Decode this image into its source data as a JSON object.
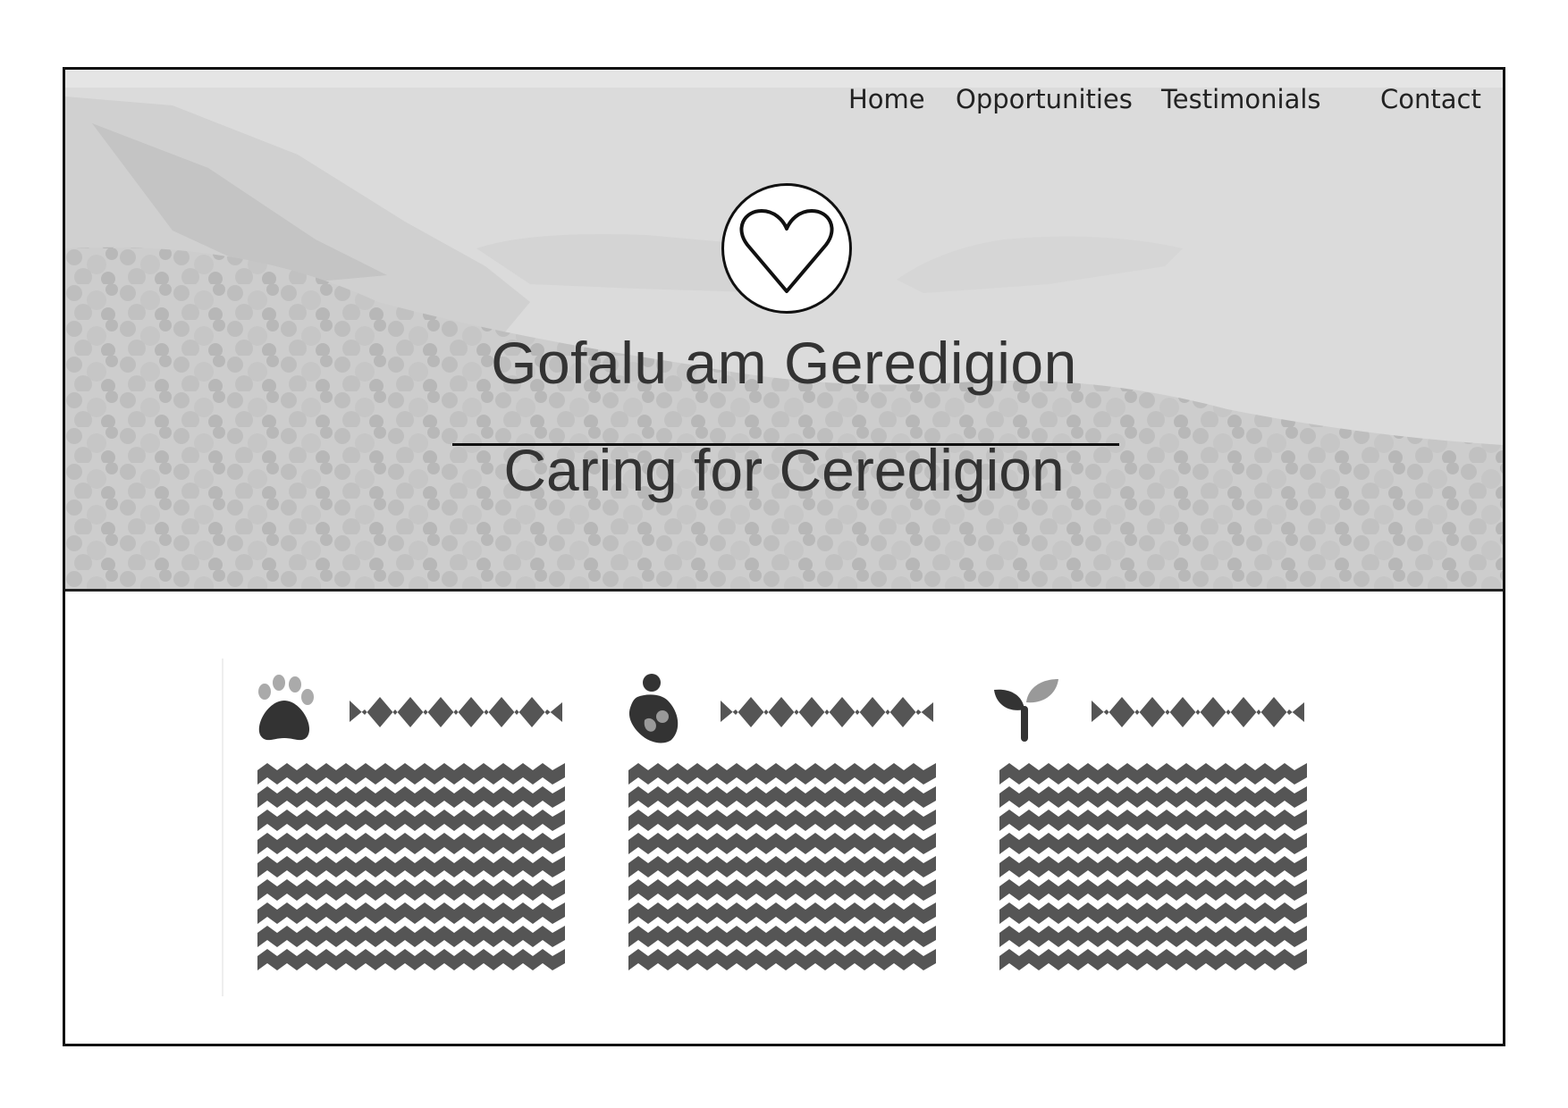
{
  "nav": {
    "items": [
      "Home",
      "Opportunities",
      "Testimonials",
      "Contact"
    ]
  },
  "hero": {
    "title": "Gofalu am Geredigion",
    "subtitle": "Caring for Ceredigion",
    "logo_icon": "heart-icon"
  },
  "features": [
    {
      "icon": "paw-icon"
    },
    {
      "icon": "parent-child-icon"
    },
    {
      "icon": "sprout-icon"
    }
  ],
  "colors": {
    "placeholder_text": "#555555",
    "frame": "#111111",
    "hero_tint": "#cfcfcf"
  }
}
